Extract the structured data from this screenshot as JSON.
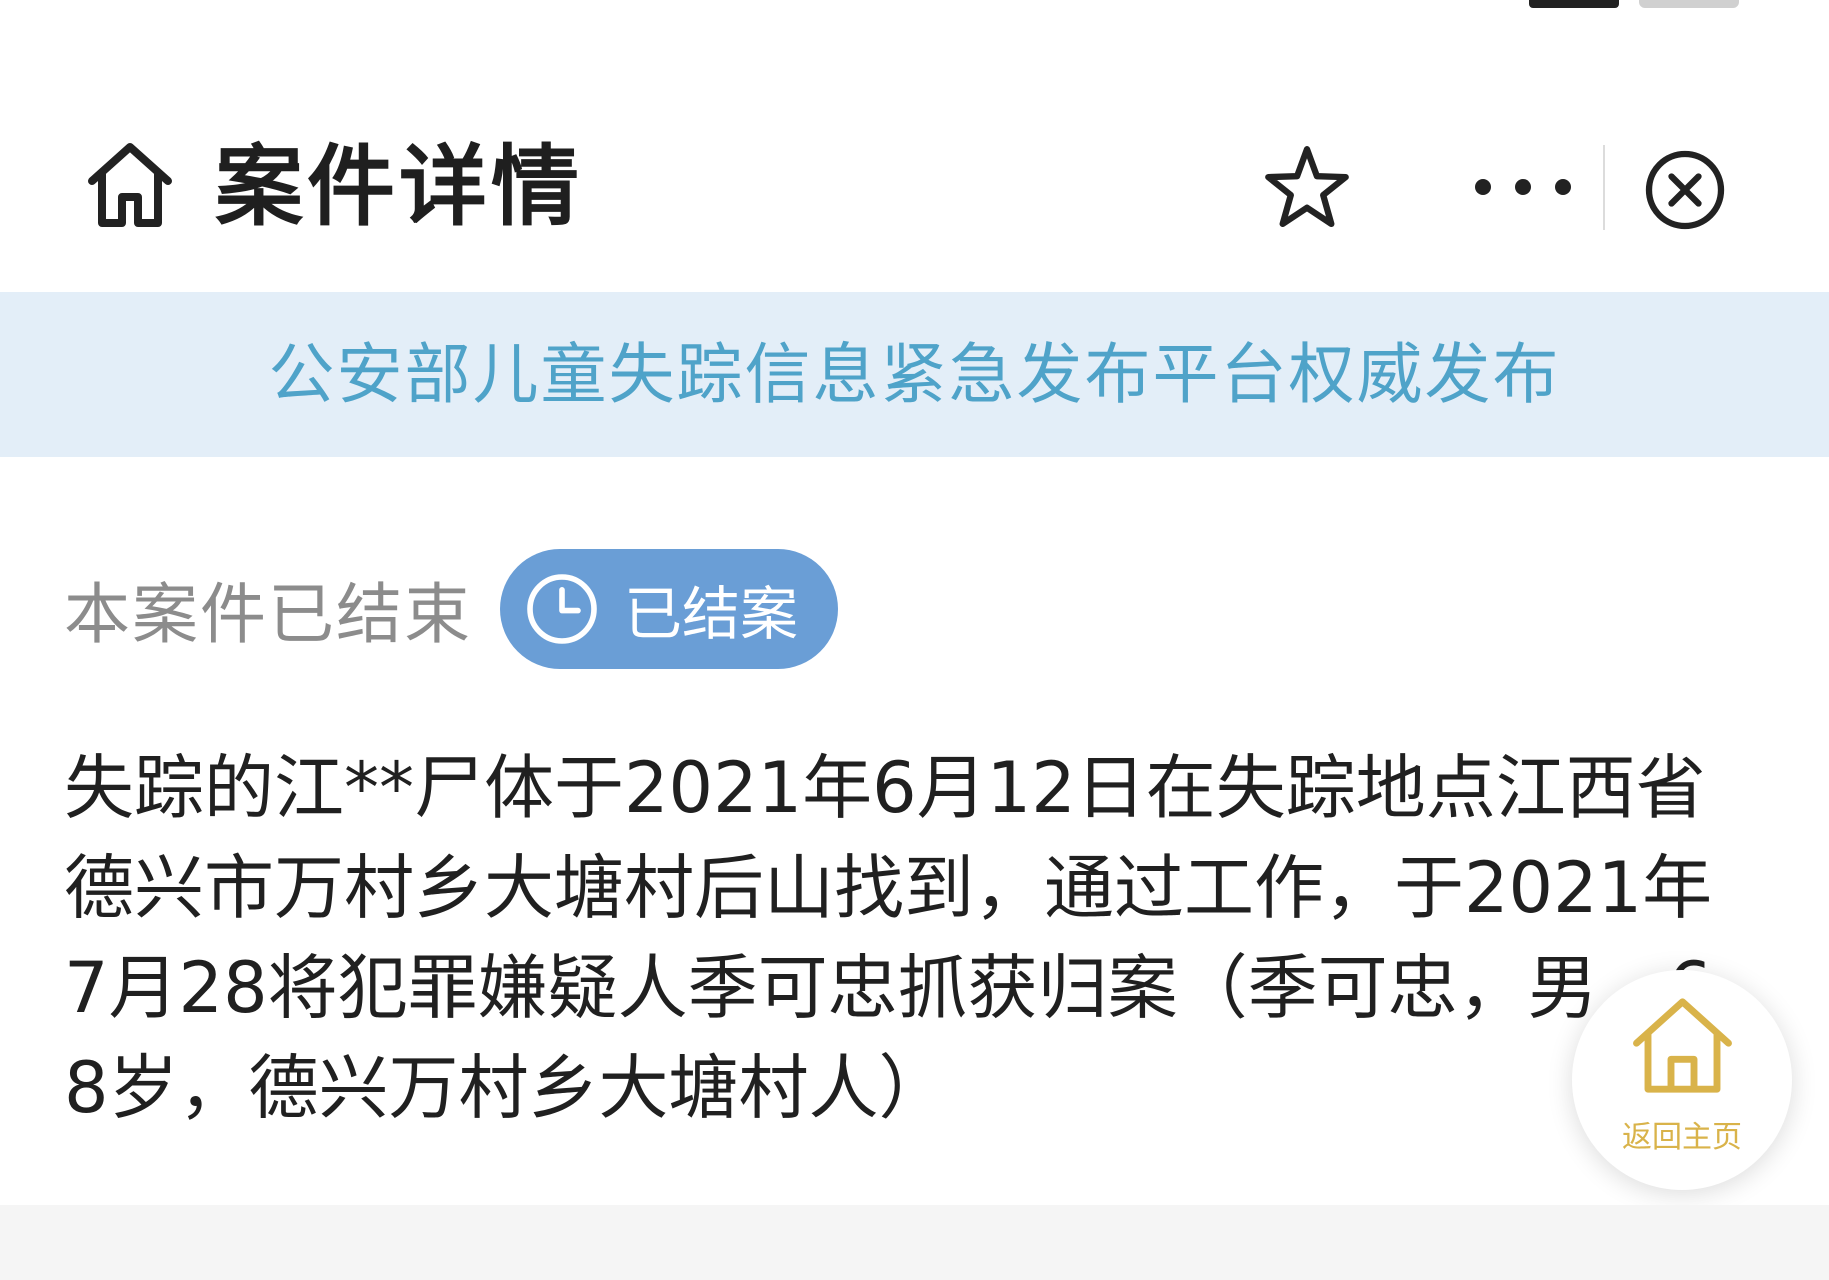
{
  "header": {
    "title": "案件详情"
  },
  "banner": {
    "text": "公安部儿童失踪信息紧急发布平台权威发布"
  },
  "case_status": {
    "text": "本案件已结束",
    "badge_label": "已结案"
  },
  "case_description": "失踪的江**尸体于2021年6月12日在失踪地点江西省德兴市万村乡大塘村后山找到，通过工作，于2021年7月28将犯罪嫌疑人季可忠抓获归案（季可忠，男，68岁，德兴万村乡大塘村人）",
  "floating_button": {
    "label": "返回主页"
  },
  "icons": {
    "home": "home-icon",
    "favorite": "star-icon",
    "more": "more-icon",
    "close": "close-icon",
    "clock": "clock-icon",
    "float_home": "home-icon"
  },
  "colors": {
    "banner_bg": "#e3eef8",
    "banner_text": "#4fa3c9",
    "badge_bg": "#6a9ed6",
    "muted_text": "#8c8c8c",
    "float_accent": "#d9b34a"
  }
}
